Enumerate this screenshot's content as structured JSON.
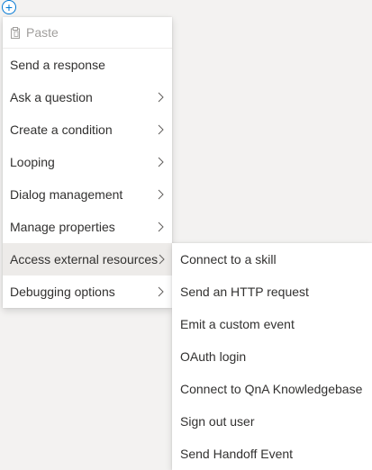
{
  "add_button": {
    "glyph": "+"
  },
  "menu": {
    "paste": {
      "label": "Paste",
      "icon": "clipboard-icon"
    },
    "items": [
      {
        "label": "Send a response",
        "has_submenu": false
      },
      {
        "label": "Ask a question",
        "has_submenu": true
      },
      {
        "label": "Create a condition",
        "has_submenu": true
      },
      {
        "label": "Looping",
        "has_submenu": true
      },
      {
        "label": "Dialog management",
        "has_submenu": true
      },
      {
        "label": "Manage properties",
        "has_submenu": true
      },
      {
        "label": "Access external resources",
        "has_submenu": true,
        "active": true
      },
      {
        "label": "Debugging options",
        "has_submenu": true
      }
    ]
  },
  "submenu": {
    "items": [
      {
        "label": "Connect to a skill"
      },
      {
        "label": "Send an HTTP request"
      },
      {
        "label": "Emit a custom event"
      },
      {
        "label": "OAuth login"
      },
      {
        "label": "Connect to QnA Knowledgebase"
      },
      {
        "label": "Sign out user"
      },
      {
        "label": "Send Handoff Event"
      }
    ]
  },
  "colors": {
    "accent": "#0078d4",
    "background": "#f3f2f1",
    "active_item": "#edebe9",
    "disabled_text": "#a19f9d",
    "text": "#323130"
  }
}
